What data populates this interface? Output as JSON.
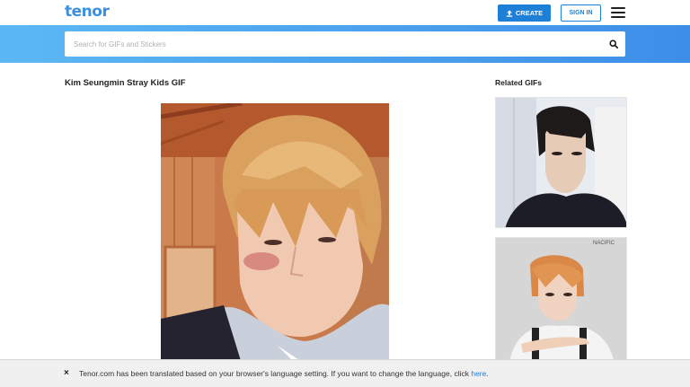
{
  "header": {
    "logo": "tenor",
    "create_label": "CREATE",
    "signin_label": "SIGN IN"
  },
  "search": {
    "placeholder": "Search for GIFs and Stickers",
    "value": ""
  },
  "main": {
    "gif_title": "Kim Seungmin Stray Kids GIF"
  },
  "related": {
    "title": "Related GIFs",
    "items": [
      {
        "watermark": ""
      },
      {
        "watermark": "NACIFIC"
      }
    ]
  },
  "notice": {
    "close_icon": "×",
    "text": "Tenor.com has been translated based on your browser's language setting. If you want to change the language, click ",
    "link": "here",
    "suffix": "."
  },
  "colors": {
    "brand": "#3a8fe0",
    "button": "#1e7fd6",
    "band_start": "#5cb8f5",
    "band_end": "#3d8ee8"
  }
}
